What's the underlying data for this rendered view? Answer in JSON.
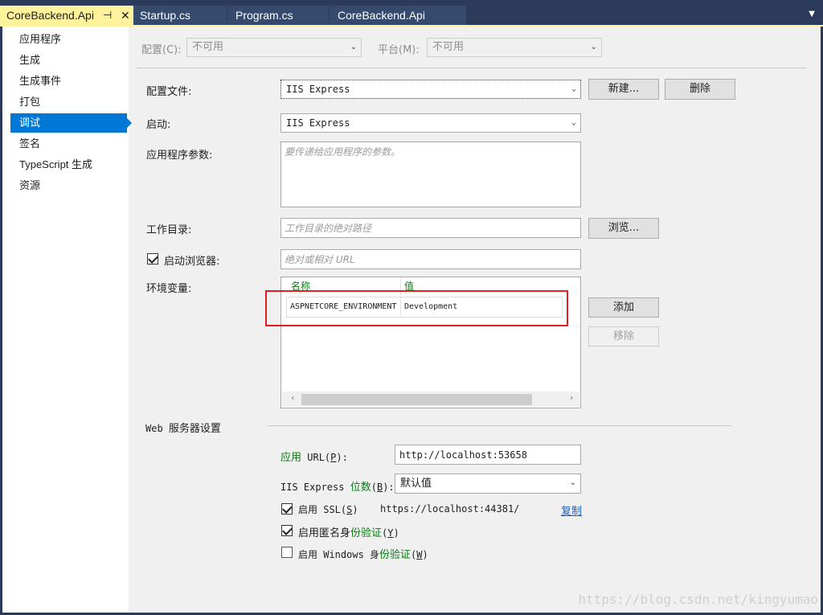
{
  "tabs": [
    {
      "label": "CoreBackend.Api",
      "active": true,
      "pin_icon": "pin-icon",
      "close_icon": "close-icon"
    },
    {
      "label": "Startup.cs",
      "active": false
    },
    {
      "label": "Program.cs",
      "active": false
    },
    {
      "label": "CoreBackend.Api",
      "active": false
    }
  ],
  "sidebar": {
    "items": [
      {
        "label": "应用程序"
      },
      {
        "label": "生成"
      },
      {
        "label": "生成事件"
      },
      {
        "label": "打包"
      },
      {
        "label": "调试",
        "selected": true
      },
      {
        "label": "签名"
      },
      {
        "label": "TypeScript 生成"
      },
      {
        "label": "资源"
      }
    ]
  },
  "config_bar": {
    "config_label": "配置(C):",
    "config_value": "不可用",
    "platform_label": "平台(M):",
    "platform_value": "不可用"
  },
  "debug": {
    "profile_label": "配置文件:",
    "profile_value": "IIS Express",
    "new_button": "新建...",
    "delete_button": "删除",
    "launch_label": "启动:",
    "launch_value": "IIS Express",
    "args_label": "应用程序参数:",
    "args_placeholder": "要传递给应用程序的参数。",
    "workdir_label": "工作目录:",
    "workdir_placeholder": "工作目录的绝对路径",
    "browse_button": "浏览...",
    "browser_label": "启动浏览器:",
    "browser_checked": true,
    "browser_placeholder": "绝对或相对 URL",
    "env_label": "环境变量:",
    "env_columns": [
      "名称",
      "值"
    ],
    "env_rows": [
      {
        "name": "ASPNETCORE_ENVIRONMENT",
        "value": "Development"
      }
    ],
    "add_button": "添加",
    "remove_button": "移除"
  },
  "web_server": {
    "section_title_prefix": "Web ",
    "section_title": "服务器设置",
    "app_url_label_1": "应用",
    "app_url_label_2": " URL(",
    "app_url_key": "P",
    "app_url_label_3": "):",
    "app_url_value": "http://localhost:53658",
    "bitness_label_1": "IIS Express ",
    "bitness_label_2": "位数",
    "bitness_label_3": "(",
    "bitness_key": "B",
    "bitness_label_4": "):",
    "bitness_value": "默认值",
    "ssl_label_1": "启用 SSL(",
    "ssl_key": "S",
    "ssl_label_2": ")",
    "ssl_checked": true,
    "ssl_url": "https://localhost:44381/",
    "copy_link": "复制",
    "anon_label_1": "启用匿名身",
    "anon_label_2": "份验证",
    "anon_label_3": "(",
    "anon_key": "Y",
    "anon_label_4": ")",
    "anon_checked": true,
    "win_label_1": "启用 Windows 身",
    "win_label_2": "份验证",
    "win_label_3": "(",
    "win_key": "W",
    "win_label_4": ")",
    "win_checked": false
  },
  "watermark": "https://blog.csdn.net/kingyumao",
  "colors": {
    "accent": "#0078d7",
    "tab_active": "#fff29d",
    "highlight_box": "#e02020"
  }
}
